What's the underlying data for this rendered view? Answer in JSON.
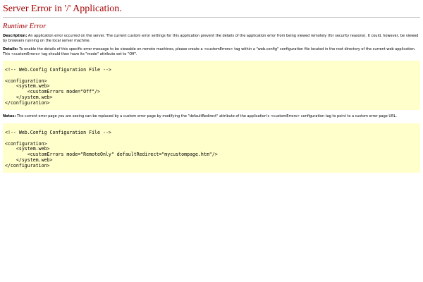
{
  "page": {
    "title": "Server Error in '/' Application.",
    "subtitle": "Runtime Error"
  },
  "description": {
    "label": "Description:",
    "text": " An application error occurred on the server. The current custom error settings for this application prevent the details of the application error from being viewed remotely (for security reasons). It could, however, be viewed by browsers running on the local server machine."
  },
  "details": {
    "label": "Details:",
    "text": " To enable the details of this specific error message to be viewable on remote machines, please create a <customErrors> tag within a \"web.config\" configuration file located in the root directory of the current web application. This <customErrors> tag should then have its \"mode\" attribute set to \"Off\"."
  },
  "code_block_1": "<!-- Web.Config Configuration File -->\n\n<configuration>\n    <system.web>\n        <customErrors mode=\"Off\"/>\n    </system.web>\n</configuration>",
  "notes": {
    "label": "Notes:",
    "text": " The current error page you are seeing can be replaced by a custom error page by modifying the \"defaultRedirect\" attribute of the application's <customErrors> configuration tag to point to a custom error page URL."
  },
  "code_block_2": "<!-- Web.Config Configuration File -->\n\n<configuration>\n    <system.web>\n        <customErrors mode=\"RemoteOnly\" defaultRedirect=\"mycustompage.htm\"/>\n    </system.web>\n</configuration>",
  "colors": {
    "heading": "#a50000",
    "code_background": "#ffffcc",
    "rule": "#c0c0c0"
  }
}
